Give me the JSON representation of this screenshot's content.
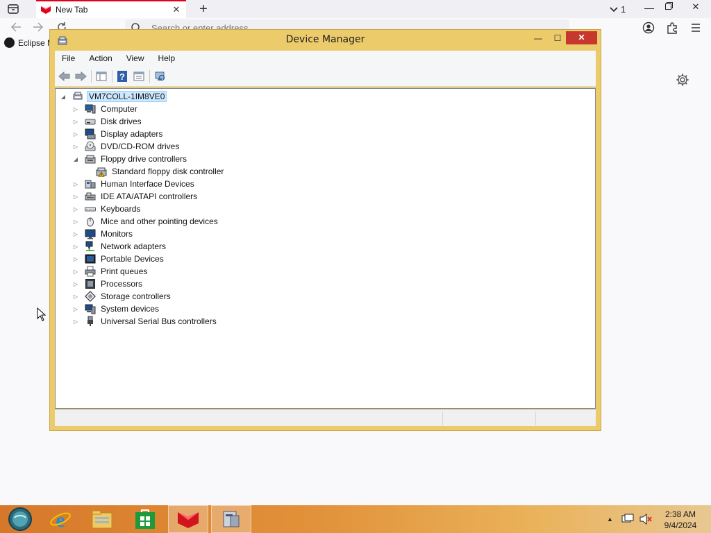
{
  "browser": {
    "tab_title": "New Tab",
    "tab_count": "1",
    "url_placeholder": "Search or enter address",
    "bookmark_label": "Eclipse M",
    "icons": [
      "tab-overview-icon",
      "close-icon",
      "plus-icon",
      "chevron-down-icon",
      "back-icon",
      "forward-icon",
      "reload-icon",
      "search-icon",
      "account-icon",
      "extensions-icon",
      "menu-icon",
      "gear-icon"
    ]
  },
  "window": {
    "title": "Device Manager",
    "buttons": {
      "minimize": "—",
      "maximize": "☐",
      "close": "✕"
    }
  },
  "menu": [
    "File",
    "Action",
    "View",
    "Help"
  ],
  "tree": {
    "root": "VM7COLL-1IM8VE0",
    "items": [
      {
        "label": "Computer",
        "icon": "computer-icon",
        "expanded": false
      },
      {
        "label": "Disk drives",
        "icon": "disk-drive-icon",
        "expanded": false
      },
      {
        "label": "Display adapters",
        "icon": "display-adapter-icon",
        "expanded": false
      },
      {
        "label": "DVD/CD-ROM drives",
        "icon": "dvd-drive-icon",
        "expanded": false
      },
      {
        "label": "Floppy drive controllers",
        "icon": "floppy-controller-icon",
        "expanded": true,
        "children": [
          "Standard floppy disk controller"
        ]
      },
      {
        "label": "Human Interface Devices",
        "icon": "hid-icon",
        "expanded": false
      },
      {
        "label": "IDE ATA/ATAPI controllers",
        "icon": "ide-controller-icon",
        "expanded": false
      },
      {
        "label": "Keyboards",
        "icon": "keyboard-icon",
        "expanded": false
      },
      {
        "label": "Mice and other pointing devices",
        "icon": "mouse-icon",
        "expanded": false
      },
      {
        "label": "Monitors",
        "icon": "monitor-icon",
        "expanded": false
      },
      {
        "label": "Network adapters",
        "icon": "network-adapter-icon",
        "expanded": false
      },
      {
        "label": "Portable Devices",
        "icon": "portable-device-icon",
        "expanded": false
      },
      {
        "label": "Print queues",
        "icon": "printer-icon",
        "expanded": false
      },
      {
        "label": "Processors",
        "icon": "processor-icon",
        "expanded": false
      },
      {
        "label": "Storage controllers",
        "icon": "storage-controller-icon",
        "expanded": false
      },
      {
        "label": "System devices",
        "icon": "system-device-icon",
        "expanded": false
      },
      {
        "label": "Universal Serial Bus controllers",
        "icon": "usb-icon",
        "expanded": false
      }
    ]
  },
  "taskbar": {
    "time": "2:38 AM",
    "date": "9/4/2024",
    "apps": [
      "start-icon",
      "internet-explorer-icon",
      "file-explorer-icon",
      "store-icon",
      "browser-icon",
      "device-manager-icon"
    ]
  },
  "colors": {
    "window_frame": "#eccb6b",
    "close_button": "#c7372d",
    "selection": "#cce8ff",
    "tab_accent": "#e2001a"
  }
}
